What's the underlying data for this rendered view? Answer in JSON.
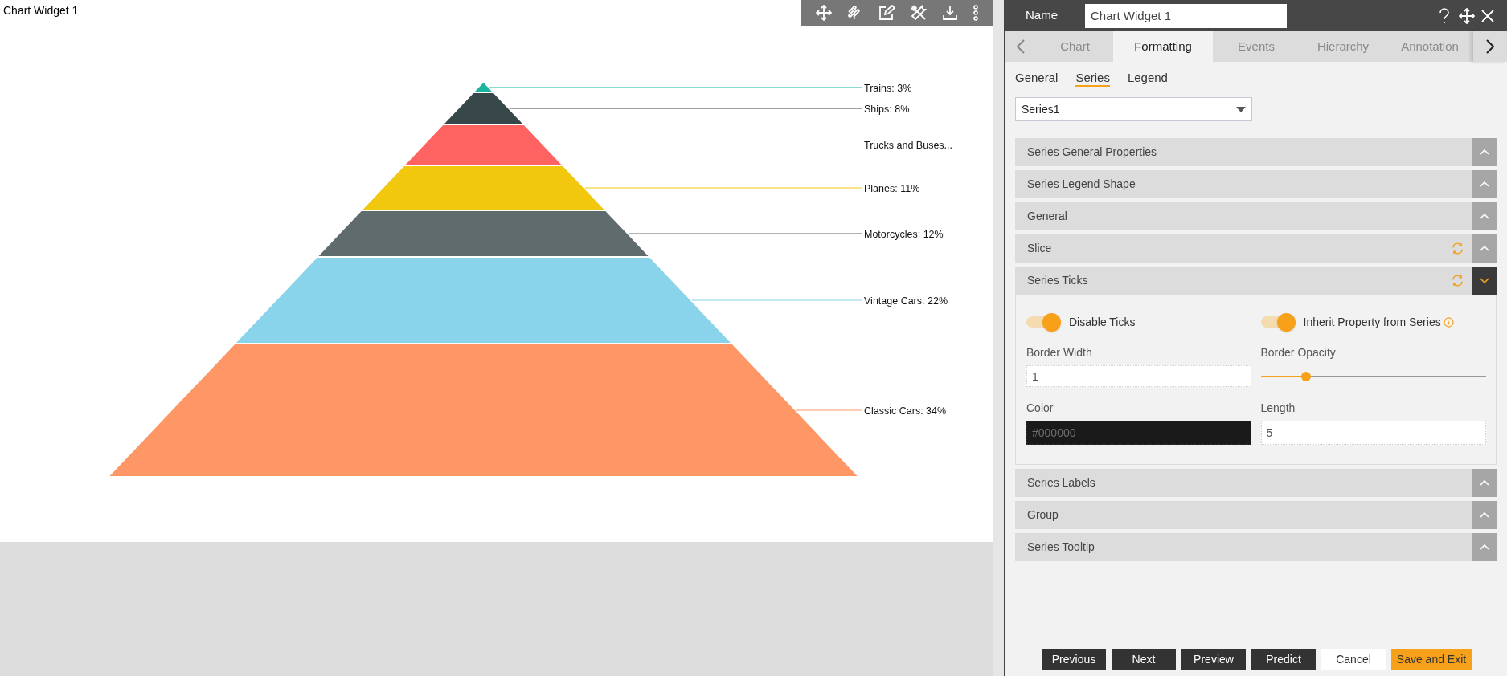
{
  "widget": {
    "title": "Chart Widget 1"
  },
  "pyramid": {
    "slices": [
      {
        "label": "Trains: 3%",
        "color": "#1ab3a0"
      },
      {
        "label": "Ships: 8%",
        "color": "#37474a"
      },
      {
        "label": "Trucks and Buses...",
        "color": "#ff6361"
      },
      {
        "label": "Planes: 11%",
        "color": "#f2c80f"
      },
      {
        "label": "Motorcycles: 12%",
        "color": "#5f6b6d"
      },
      {
        "label": "Vintage Cars: 22%",
        "color": "#8ad4eb"
      },
      {
        "label": "Classic Cars: 34%",
        "color": "#fe9666"
      }
    ]
  },
  "panel": {
    "name_label": "Name",
    "name_value": "Chart Widget 1",
    "tabs": [
      {
        "label": "Chart",
        "selected": false
      },
      {
        "label": "Formatting",
        "selected": true
      },
      {
        "label": "Events",
        "selected": false
      },
      {
        "label": "Hierarchy",
        "selected": false
      },
      {
        "label": "Annotation",
        "selected": false
      }
    ],
    "subtabs": [
      {
        "label": "General",
        "selected": false
      },
      {
        "label": "Series",
        "selected": true
      },
      {
        "label": "Legend",
        "selected": false
      }
    ],
    "series_select": "Series1",
    "sections": [
      {
        "title": "Series General Properties",
        "expanded": false,
        "reset": false
      },
      {
        "title": "Series Legend Shape",
        "expanded": false,
        "reset": false
      },
      {
        "title": "General",
        "expanded": false,
        "reset": false
      },
      {
        "title": "Slice",
        "expanded": false,
        "reset": true
      },
      {
        "title": "Series Ticks",
        "expanded": true,
        "reset": true
      },
      {
        "title": "Series Labels",
        "expanded": false,
        "reset": false
      },
      {
        "title": "Group",
        "expanded": false,
        "reset": false
      },
      {
        "title": "Series Tooltip",
        "expanded": false,
        "reset": false
      }
    ],
    "ticks_settings": {
      "toggles": [
        {
          "label": "Disable Ticks",
          "on": true,
          "info": false
        },
        {
          "label": "Inherit Property from Series",
          "on": true,
          "info": true
        }
      ],
      "border_width": {
        "label": "Border Width",
        "value": "1"
      },
      "border_opacity": {
        "label": "Border Opacity",
        "level": 0.2
      },
      "color": {
        "label": "Color",
        "placeholder": "#000000"
      },
      "length": {
        "label": "Length",
        "value": "5"
      }
    },
    "buttons": [
      {
        "label": "Previous",
        "kind": "dark"
      },
      {
        "label": "Next",
        "kind": "dark"
      },
      {
        "label": "Preview",
        "kind": "dark"
      },
      {
        "label": "Predict",
        "kind": "dark"
      },
      {
        "label": "Cancel",
        "kind": "light"
      },
      {
        "label": "Save and Exit",
        "kind": "primary"
      }
    ]
  }
}
